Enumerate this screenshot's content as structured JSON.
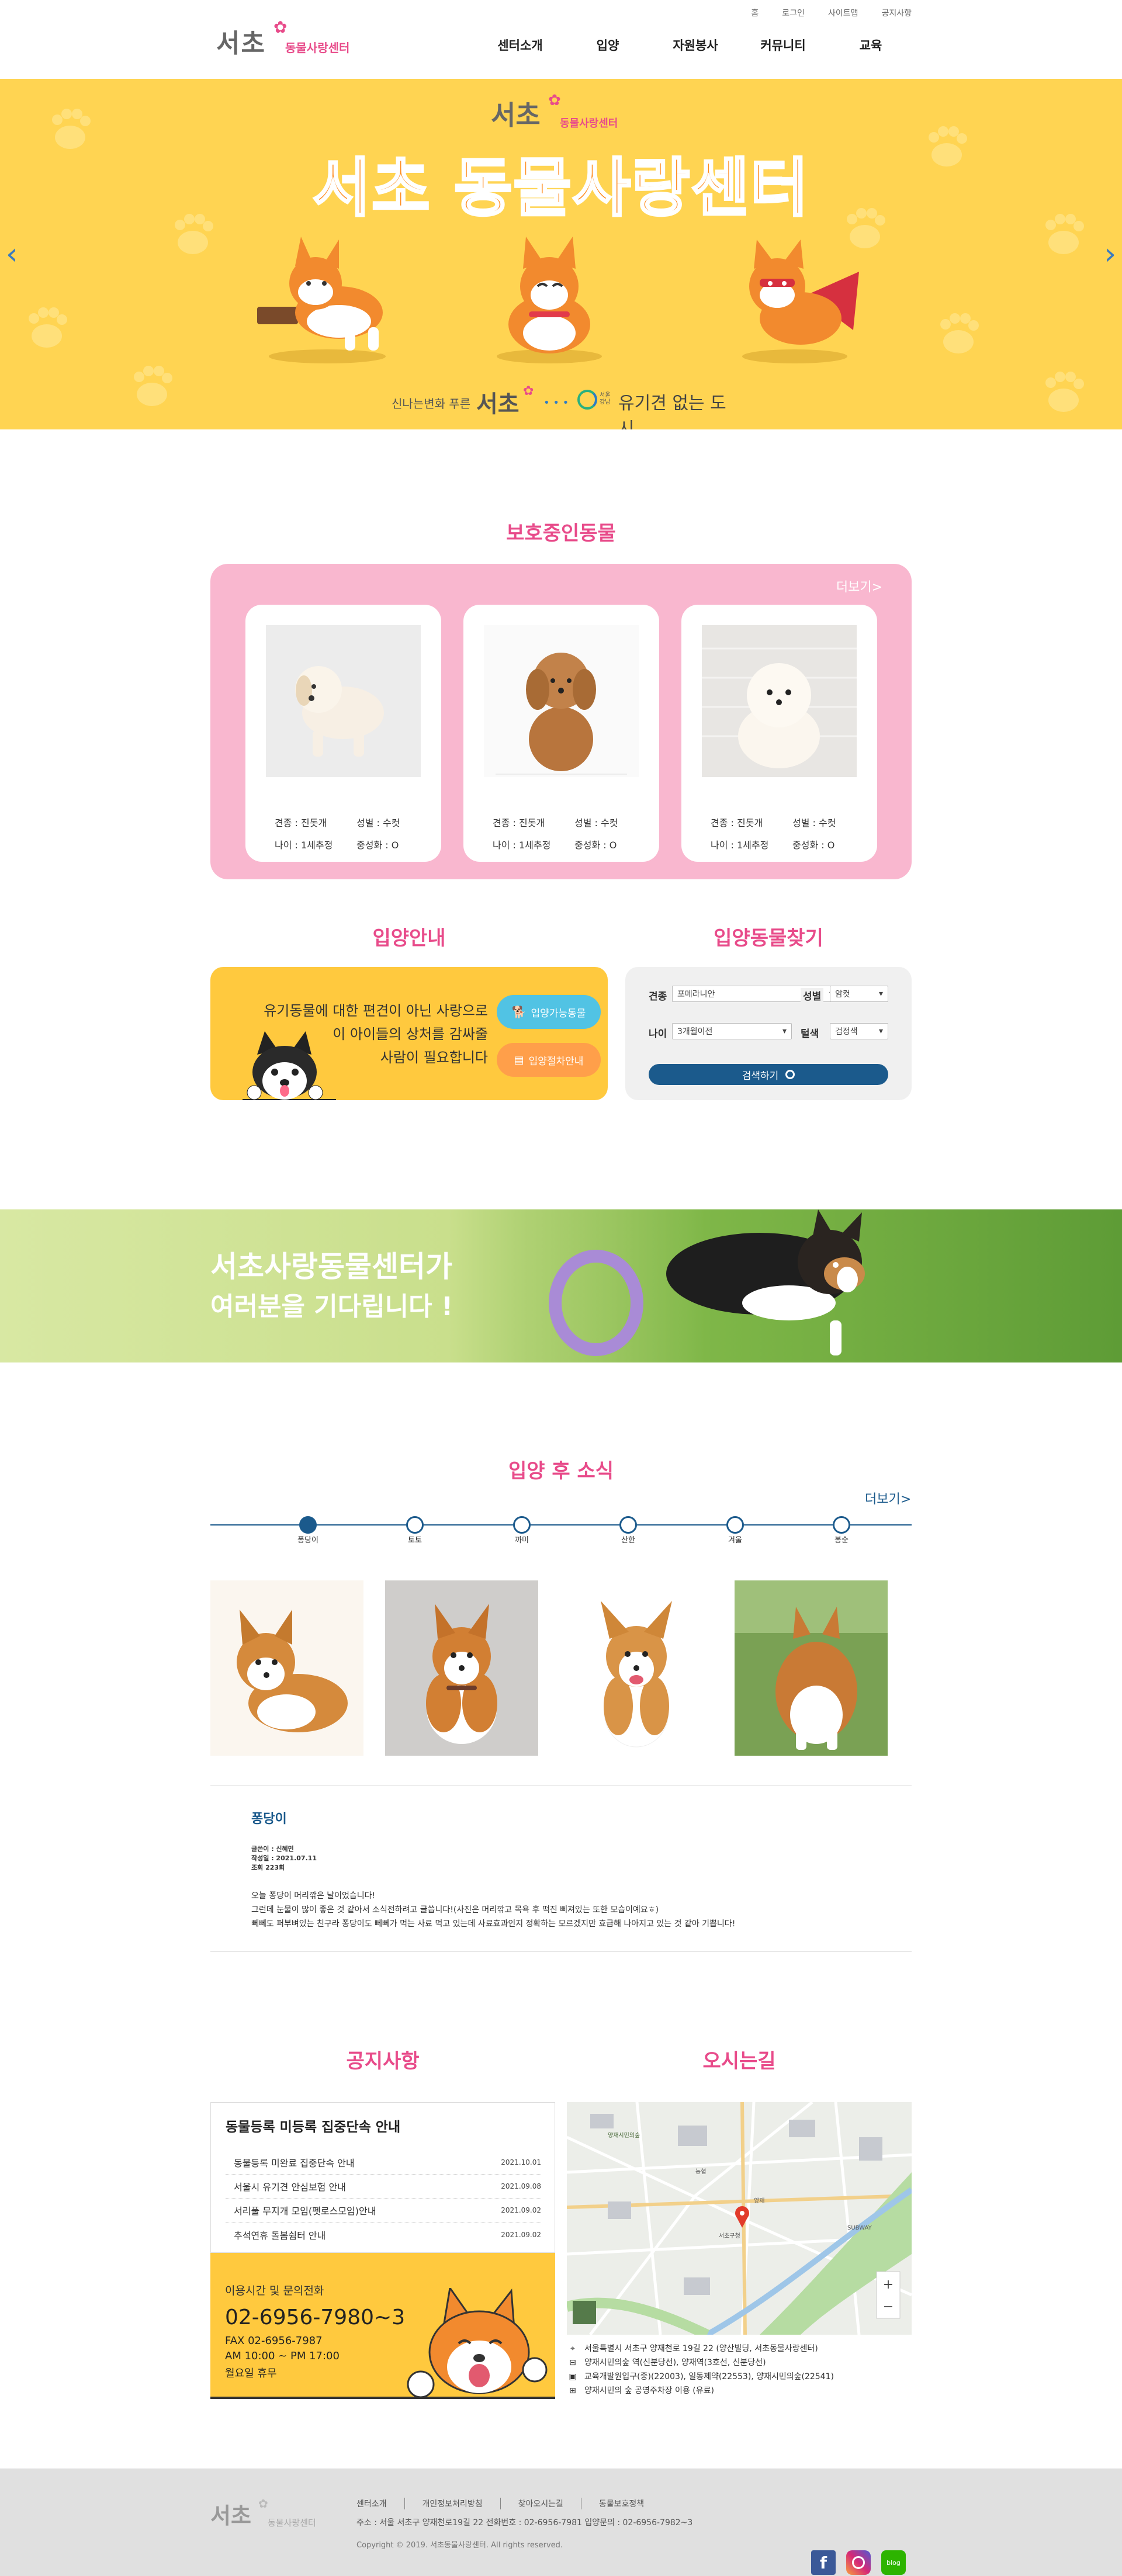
{
  "header": {
    "logo_main": "서초",
    "logo_sub": "동물사랑센터",
    "util_links": [
      "홈",
      "로그인",
      "사이트맵",
      "공지사항"
    ],
    "nav": [
      "센터소개",
      "입양",
      "자원봉사",
      "커뮤니티",
      "교육"
    ]
  },
  "hero": {
    "logo_main": "서초",
    "logo_sub": "동물사랑센터",
    "title": "서초 동물사랑센터",
    "slogan_left_small": "신나는변화 푸른",
    "slogan_left_big": "서초",
    "slogan_right_small": "서울 강남",
    "slogan_right_big": "유기견 없는 도시",
    "bg_color": "#ffd452",
    "title_color": "#ff8a1c"
  },
  "protect": {
    "title": "보호중인동물",
    "more": "더보기>",
    "cards": [
      {
        "breed": "견종 : 진돗개",
        "sex": "성별 : 수컷",
        "age": "나이 : 1세추정",
        "neuter": "중성화 : O"
      },
      {
        "breed": "견종 : 진돗개",
        "sex": "성별 : 수컷",
        "age": "나이 : 1세추정",
        "neuter": "중성화 : O"
      },
      {
        "breed": "견종 : 진돗개",
        "sex": "성별 : 수컷",
        "age": "나이 : 1세추정",
        "neuter": "중성화 : O"
      }
    ]
  },
  "adopt_info": {
    "title": "입양안내",
    "line1": "유기동물에 대한 편견이 아닌 사랑으로",
    "line2": "이 아이들의 상처를 감싸줄",
    "line3": "사람이 필요합니다",
    "btn_available": "입양가능동물",
    "btn_procedure": "입양절차안내"
  },
  "adopt_search": {
    "title": "입양동물찾기",
    "breed_label": "견종",
    "breed_value": "포메라니안",
    "sex_label": "성별",
    "sex_value": "암컷",
    "age_label": "나이",
    "age_value": "3개월이전",
    "color_label": "털색",
    "color_value": "검정색",
    "search_btn": "검색하기"
  },
  "banner": {
    "line1": "서초사랑동물센터가",
    "line2": "여러분을 기다립니다 !"
  },
  "news": {
    "title": "입양 후 소식",
    "more": "더보기>",
    "timeline": [
      "퐁당이",
      "토토",
      "까미",
      "산한",
      "겨울",
      "봉순"
    ],
    "post_title": "퐁당이",
    "author": "글쓴이 : 신혜민",
    "date": "작성일 : 2021.07.11",
    "views": "조회 223회",
    "body1": "오늘 퐁당이 머리깎은 날이었습니다!",
    "body2": "그런데 눈물이 많이 좋은 것 같아서 소식전하려고 글씁니다!(사진은 머리깎고 목욕 후 떡진 삐져있는 또한 모습이예요ㅎ)",
    "body3": "뻬뻬도 퍼부벼있는 친구라 퐁당이도 뻬뻬가 먹는 사료 먹고 있는데 사료효과인지 정확하는 모르겠지만 효급해 나아지고 있는 것 같아 기쁩니다!"
  },
  "notice": {
    "title": "공지사항",
    "headline": "동물등록 미등록 집중단속 안내",
    "items": [
      {
        "text": "동물등록 미완료 집중단속 안내",
        "date": "2021.10.01"
      },
      {
        "text": "서울시 유기견 안심보험 안내",
        "date": "2021.09.08"
      },
      {
        "text": "서리풀 무지개 모임(펫로스모임)안내",
        "date": "2021.09.02"
      },
      {
        "text": "추석연휴 돌봄쉼터 안내",
        "date": "2021.09.02"
      }
    ],
    "hours_title": "이용시간 및 문의전화",
    "phone": "02-6956-7980~3",
    "fax": "FAX 02-6956-7987",
    "am": "AM 10:00 ~ PM 17:00",
    "holiday": "월요일 휴무"
  },
  "directions": {
    "title": "오시는길",
    "addr": "서울특별시 서초구 양재천로 19길 22 (양산빌딩, 서초동물사랑센터)",
    "subway": "양재시민의숲 역(신분당선), 양재역(3호선, 신분당선)",
    "bus": "교육개발원입구(중)(22003), 일동제약(22553), 양재시민의숲(22541)",
    "parking": "양재시민의 숲 공영주차장 이용 (유료)",
    "map_labels": [
      "양재시민의숲",
      "농협",
      "서초구청",
      "양재",
      "SUBWAY"
    ]
  },
  "footer": {
    "links": [
      "센터소개",
      "개인정보처리방침",
      "찾아오시는길",
      "동물보호정책"
    ],
    "addr": "주소 : 서울 서초구 양재천로19길 22 전화번호 : 02-6956-7981 입양문의 : 02-6956-7982~3",
    "copyright": "Copyright © 2019. 서초동물사랑센터. All rights reserved.",
    "logo_main": "서초",
    "logo_sub": "동물사랑센터",
    "blog": "blog"
  },
  "colors": {
    "pink": "#e84b8a",
    "yellow": "#ffd452",
    "navy": "#1b5a8c",
    "card_pink": "#f9b7cf"
  }
}
